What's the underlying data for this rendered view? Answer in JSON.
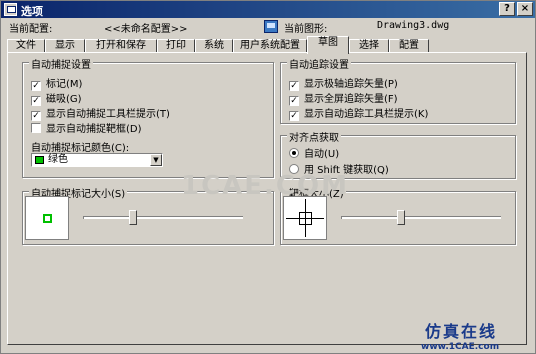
{
  "window": {
    "title": "选项"
  },
  "header": {
    "profile_label": "当前配置:",
    "profile_value": "<<未命名配置>>",
    "drawing_label": "当前图形:",
    "drawing_value": "Drawing3.dwg"
  },
  "tabs": [
    {
      "label": "文件"
    },
    {
      "label": "显示"
    },
    {
      "label": "打开和保存"
    },
    {
      "label": "打印"
    },
    {
      "label": "系统"
    },
    {
      "label": "用户系统配置"
    },
    {
      "label": "草图",
      "active": true
    },
    {
      "label": "选择"
    },
    {
      "label": "配置"
    }
  ],
  "autosnap": {
    "title": "自动捕捉设置",
    "options": [
      {
        "label": "标记(M)",
        "checked": true
      },
      {
        "label": "磁吸(G)",
        "checked": true
      },
      {
        "label": "显示自动捕捉工具栏提示(T)",
        "checked": true
      },
      {
        "label": "显示自动捕捉靶框(D)",
        "checked": false
      }
    ],
    "color_label": "自动捕捉标记颜色(C):",
    "color_value": "绿色",
    "color_swatch": "#00c000"
  },
  "autotrack": {
    "title": "自动追踪设置",
    "options": [
      {
        "label": "显示极轴追踪矢量(P)",
        "checked": true
      },
      {
        "label": "显示全屏追踪矢量(F)",
        "checked": true
      },
      {
        "label": "显示自动追踪工具栏提示(K)",
        "checked": true
      }
    ]
  },
  "alignment": {
    "title": "对齐点获取",
    "options": [
      {
        "label": "自动(U)",
        "selected": true
      },
      {
        "label": "用 Shift 键获取(Q)",
        "selected": false
      }
    ]
  },
  "marker_size": {
    "title": "自动捕捉标记大小(S)",
    "level": 0.3
  },
  "aperture_size": {
    "title": "靶框大小(Z)",
    "level": 0.37
  },
  "watermark": {
    "center": "1CAE.COM",
    "brand": "仿真在线",
    "url": "www.1CAE.com"
  },
  "controls": {
    "help": "?",
    "close": "×"
  }
}
